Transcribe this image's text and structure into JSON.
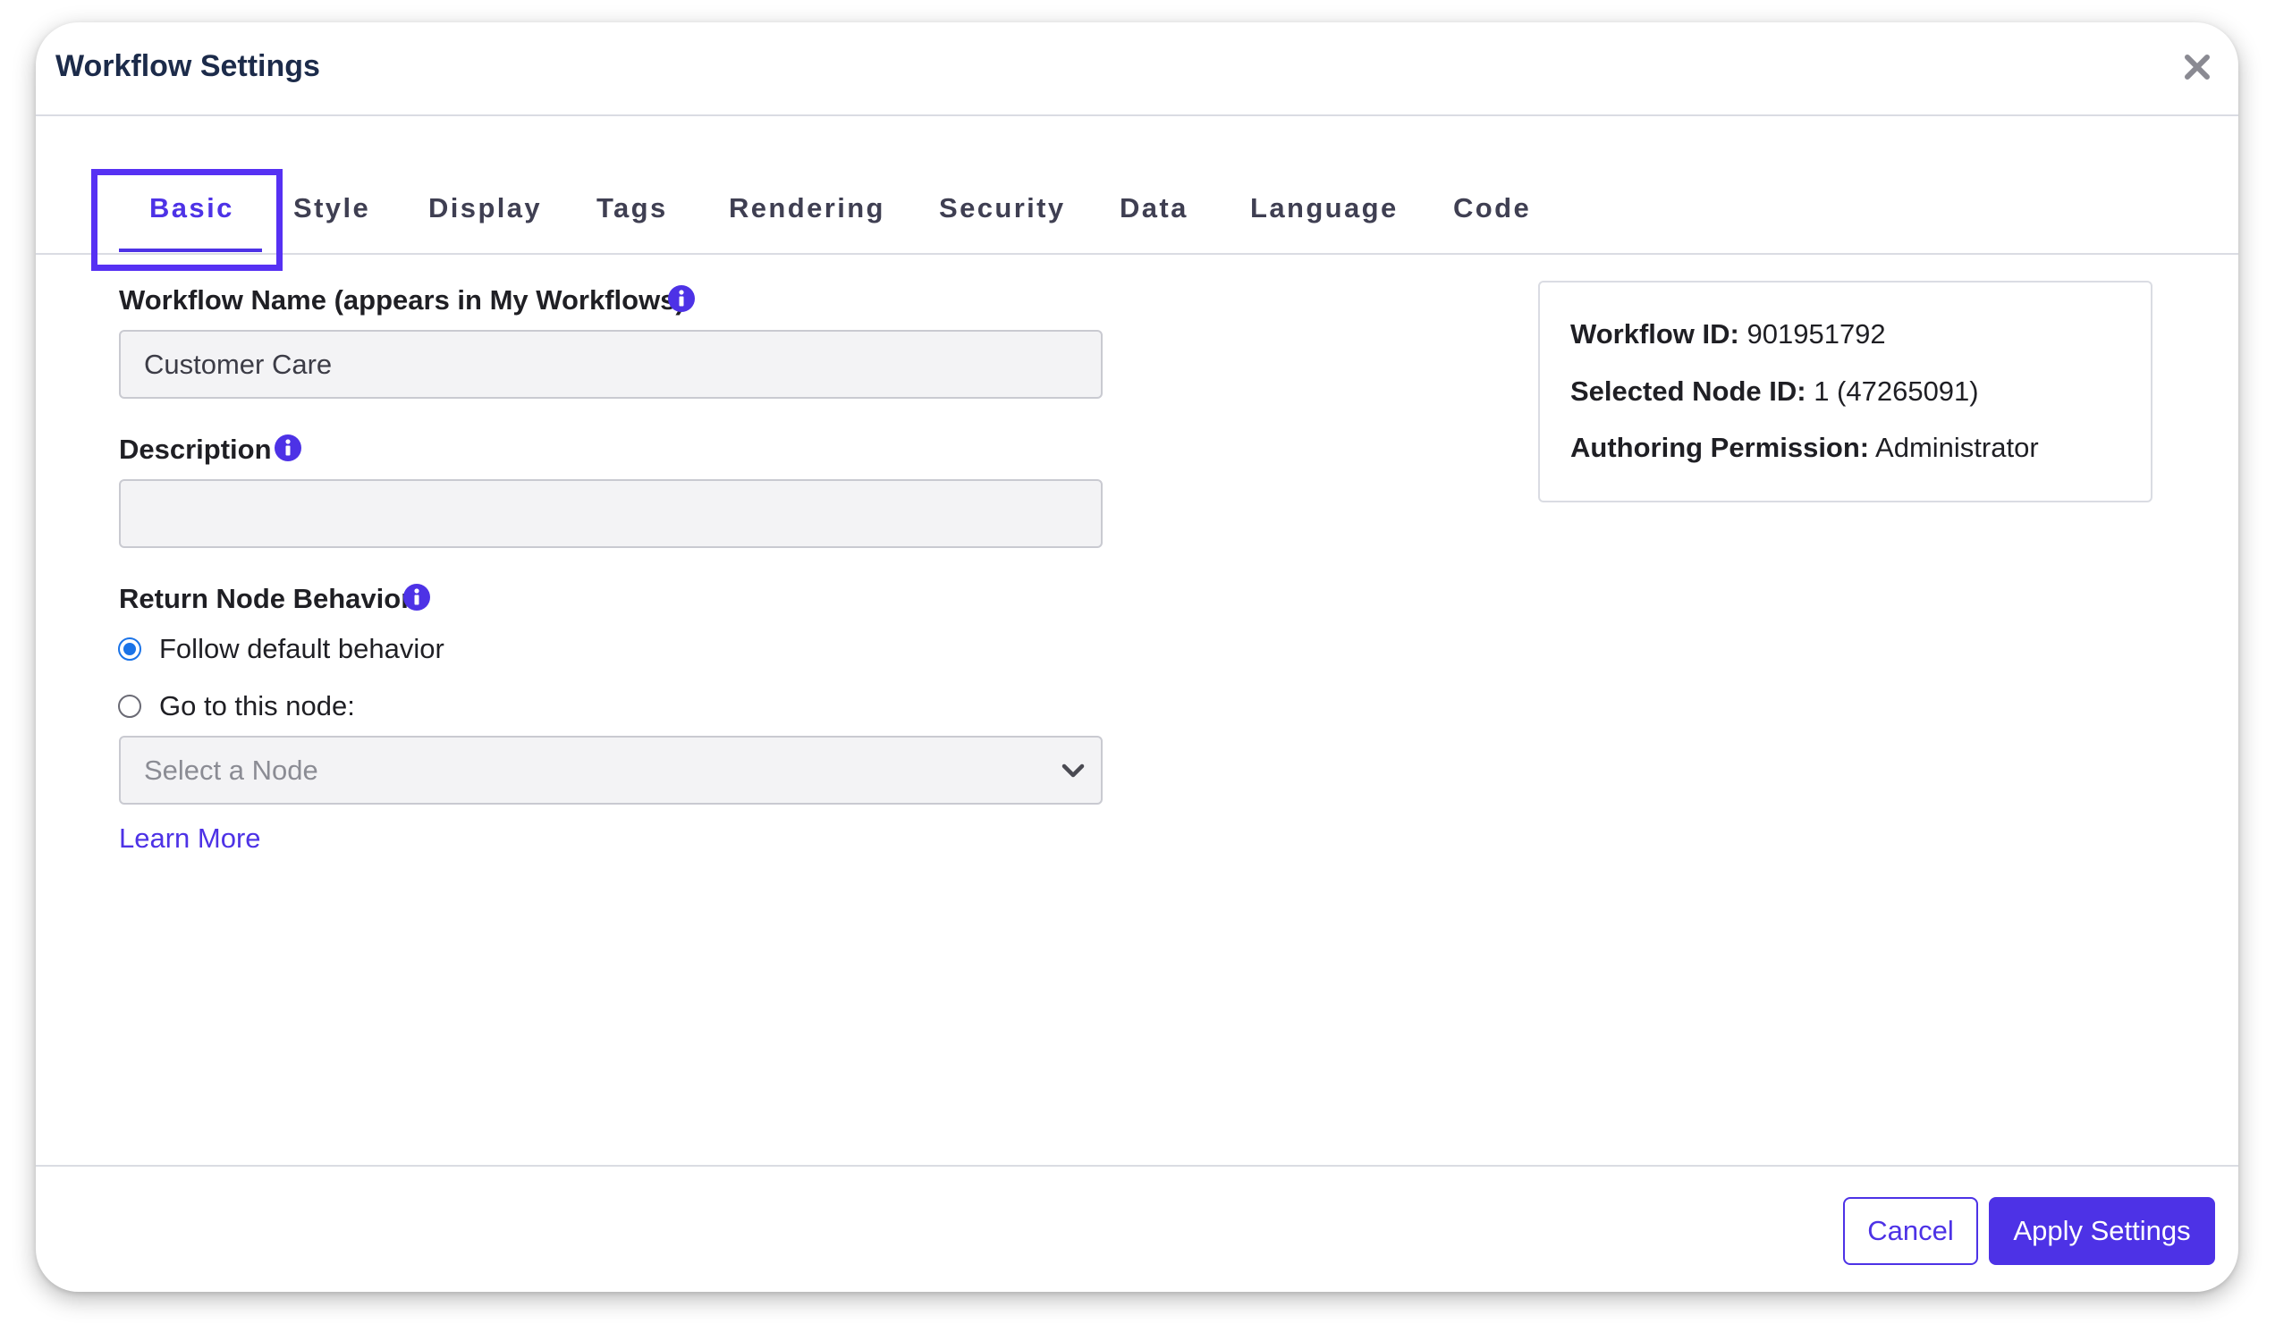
{
  "dialog": {
    "title": "Workflow Settings"
  },
  "tabs": [
    {
      "label": "Basic",
      "active": true
    },
    {
      "label": "Style",
      "active": false
    },
    {
      "label": "Display",
      "active": false
    },
    {
      "label": "Tags",
      "active": false
    },
    {
      "label": "Rendering",
      "active": false
    },
    {
      "label": "Security",
      "active": false
    },
    {
      "label": "Data",
      "active": false
    },
    {
      "label": "Language",
      "active": false
    },
    {
      "label": "Code",
      "active": false
    }
  ],
  "form": {
    "name_label": "Workflow Name (appears in My Workflows)",
    "name_value": "Customer Care",
    "description_label": "Description",
    "description_value": "",
    "return_behavior_label": "Return Node Behavior",
    "radio_default": "Follow default behavior",
    "radio_goto": "Go to this node:",
    "selected_option": "default",
    "node_select_placeholder": "Select a Node",
    "learn_more": "Learn More"
  },
  "info_panel": {
    "workflow_id_label": "Workflow ID:",
    "workflow_id_value": "901951792",
    "node_id_label": "Selected Node ID:",
    "node_id_value": "1 (47265091)",
    "permission_label": "Authoring Permission:",
    "permission_value": "Administrator"
  },
  "footer": {
    "cancel_label": "Cancel",
    "apply_label": "Apply Settings"
  },
  "colors": {
    "accent": "#4d32e6",
    "focus_ring": "#5631f3",
    "radio_checked": "#1a73e8",
    "title": "#1c2b4a"
  },
  "icons": [
    "close-icon",
    "info-icon",
    "chevron-down-icon"
  ]
}
